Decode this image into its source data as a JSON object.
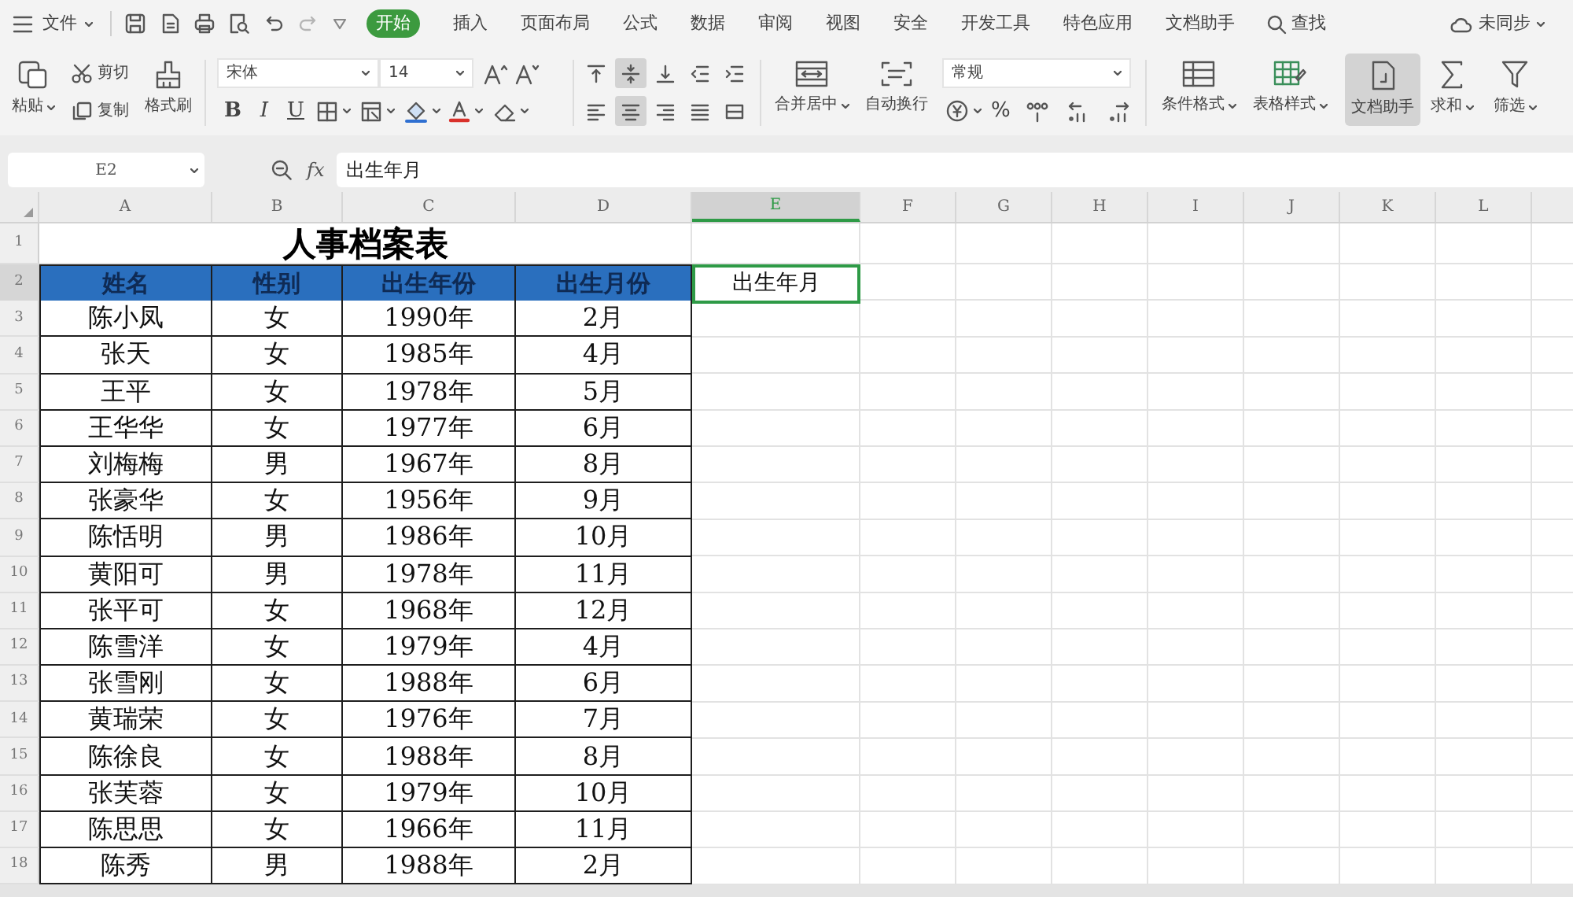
{
  "menu_bar": {
    "file_menu": "文件",
    "tabs": [
      {
        "label": "开始",
        "selected": true
      },
      {
        "label": "插入",
        "selected": false
      },
      {
        "label": "页面布局",
        "selected": false
      },
      {
        "label": "公式",
        "selected": false
      },
      {
        "label": "数据",
        "selected": false
      },
      {
        "label": "审阅",
        "selected": false
      },
      {
        "label": "视图",
        "selected": false
      },
      {
        "label": "安全",
        "selected": false
      },
      {
        "label": "开发工具",
        "selected": false
      },
      {
        "label": "特色应用",
        "selected": false
      },
      {
        "label": "文档助手",
        "selected": false
      }
    ],
    "search": "查找",
    "sync_status": "未同步"
  },
  "ribbon": {
    "paste": "粘贴",
    "cut": "剪切",
    "copy": "复制",
    "format_painter": "格式刷",
    "font_name": "宋体",
    "font_size": "14",
    "text_styles": [
      "B",
      "I",
      "U"
    ],
    "alignment": [
      {
        "kind": "top",
        "selected": false
      },
      {
        "kind": "middle",
        "selected": true
      },
      {
        "kind": "bottom",
        "selected": false
      },
      {
        "kind": "outdent",
        "selected": false
      },
      {
        "kind": "indent",
        "selected": false
      },
      {
        "kind": "left",
        "selected": false
      },
      {
        "kind": "center",
        "selected": true
      },
      {
        "kind": "right",
        "selected": false
      },
      {
        "kind": "justify",
        "selected": false
      },
      {
        "kind": "distribute",
        "selected": false
      }
    ],
    "merge": "合并居中",
    "wrap": "自动换行",
    "number_format": "常规",
    "percent": "%",
    "conditional_format": "条件格式",
    "table_style": "表格样式",
    "assistant": {
      "label": "文档助手",
      "selected": true
    },
    "sum": "求和",
    "filter": "筛选"
  },
  "formula_bar": {
    "name_box": "E2",
    "function_label": "fx",
    "formula": "出生年月"
  },
  "sheet": {
    "columns": [
      {
        "label": "A",
        "selected": false
      },
      {
        "label": "B",
        "selected": false
      },
      {
        "label": "C",
        "selected": false
      },
      {
        "label": "D",
        "selected": false
      },
      {
        "label": "E",
        "selected": true
      },
      {
        "label": "F",
        "selected": false
      },
      {
        "label": "G",
        "selected": false
      },
      {
        "label": "H",
        "selected": false
      },
      {
        "label": "I",
        "selected": false
      },
      {
        "label": "J",
        "selected": false
      },
      {
        "label": "K",
        "selected": false
      },
      {
        "label": "L",
        "selected": false
      }
    ],
    "rows": [
      {
        "number": "1",
        "selected": false,
        "kind": "title",
        "title": "人事档案表"
      },
      {
        "number": "2",
        "selected": true,
        "kind": "header",
        "cells": [
          "姓名",
          "性别",
          "出生年份",
          "出生月份"
        ],
        "note_cell": {
          "value": "出生年月",
          "selected": true
        }
      },
      {
        "number": "3",
        "selected": false,
        "kind": "record",
        "cells": [
          "陈小凤",
          "女",
          "1990年",
          "2月"
        ]
      },
      {
        "number": "4",
        "selected": false,
        "kind": "record",
        "cells": [
          "张天",
          "女",
          "1985年",
          "4月"
        ]
      },
      {
        "number": "5",
        "selected": false,
        "kind": "record",
        "cells": [
          "王平",
          "女",
          "1978年",
          "5月"
        ]
      },
      {
        "number": "6",
        "selected": false,
        "kind": "record",
        "cells": [
          "王华华",
          "女",
          "1977年",
          "6月"
        ]
      },
      {
        "number": "7",
        "selected": false,
        "kind": "record",
        "cells": [
          "刘梅梅",
          "男",
          "1967年",
          "8月"
        ]
      },
      {
        "number": "8",
        "selected": false,
        "kind": "record",
        "cells": [
          "张豪华",
          "女",
          "1956年",
          "9月"
        ]
      },
      {
        "number": "9",
        "selected": false,
        "kind": "record",
        "cells": [
          "陈恬明",
          "男",
          "1986年",
          "10月"
        ]
      },
      {
        "number": "10",
        "selected": false,
        "kind": "record",
        "cells": [
          "黄阳可",
          "男",
          "1978年",
          "11月"
        ]
      },
      {
        "number": "11",
        "selected": false,
        "kind": "record",
        "cells": [
          "张平可",
          "女",
          "1968年",
          "12月"
        ]
      },
      {
        "number": "12",
        "selected": false,
        "kind": "record",
        "cells": [
          "陈雪洋",
          "女",
          "1979年",
          "4月"
        ]
      },
      {
        "number": "13",
        "selected": false,
        "kind": "record",
        "cells": [
          "张雪刚",
          "女",
          "1988年",
          "6月"
        ]
      },
      {
        "number": "14",
        "selected": false,
        "kind": "record",
        "cells": [
          "黄瑞荣",
          "女",
          "1976年",
          "7月"
        ]
      },
      {
        "number": "15",
        "selected": false,
        "kind": "record",
        "cells": [
          "陈徐良",
          "女",
          "1988年",
          "8月"
        ]
      },
      {
        "number": "16",
        "selected": false,
        "kind": "record",
        "cells": [
          "张芙蓉",
          "女",
          "1979年",
          "10月"
        ]
      },
      {
        "number": "17",
        "selected": false,
        "kind": "record",
        "cells": [
          "陈思思",
          "女",
          "1966年",
          "11月"
        ]
      },
      {
        "number": "18",
        "selected": false,
        "kind": "record",
        "cells": [
          "陈秀",
          "男",
          "1988年",
          "2月"
        ]
      }
    ]
  }
}
